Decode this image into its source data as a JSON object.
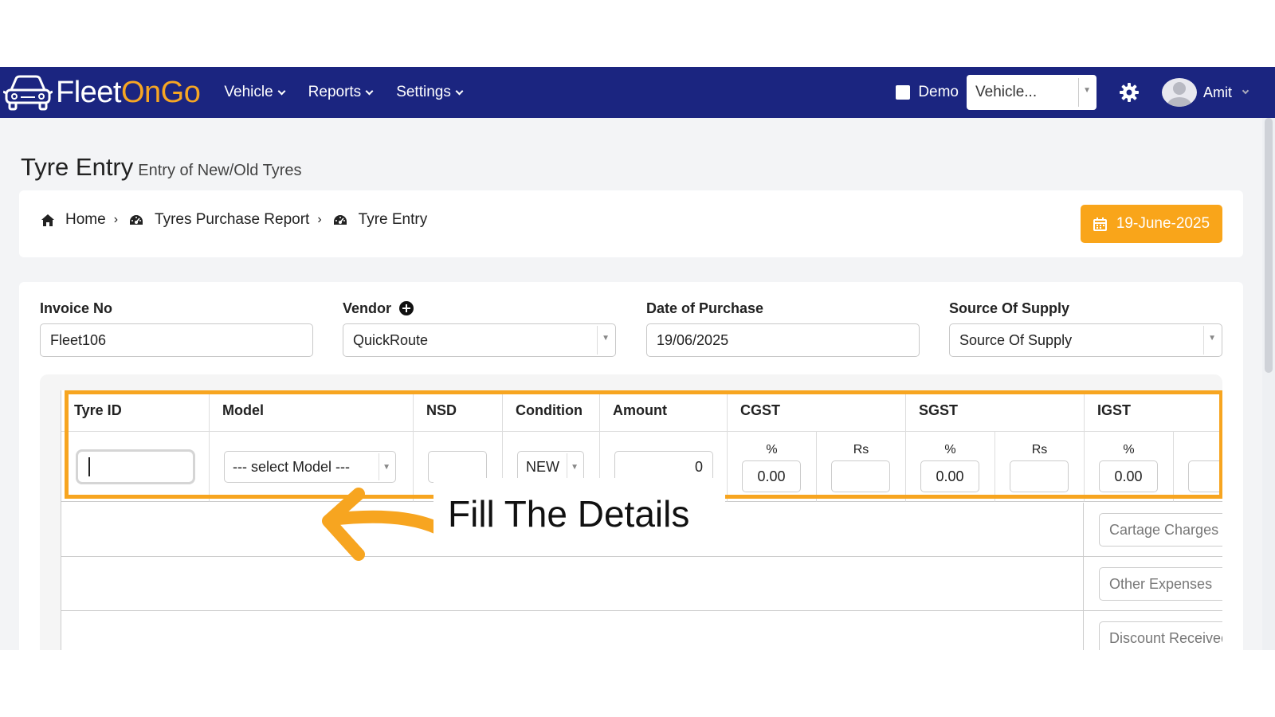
{
  "navbar": {
    "logo_text_a": "Fleet",
    "logo_text_b": "OnGo",
    "menu": [
      {
        "label": "Vehicle"
      },
      {
        "label": "Reports"
      },
      {
        "label": "Settings"
      }
    ],
    "demo_label": "Demo",
    "vehicle_select": "Vehicle...",
    "user_name": "Amit"
  },
  "page": {
    "title": "Tyre Entry",
    "subtitle": "Entry of New/Old Tyres"
  },
  "breadcrumb": {
    "items": [
      "Home",
      "Tyres Purchase Report",
      "Tyre Entry"
    ],
    "date": "19-June-2025"
  },
  "form": {
    "invoice_label": "Invoice No",
    "invoice_value": "Fleet106",
    "vendor_label": "Vendor",
    "vendor_value": "QuickRoute",
    "date_label": "Date of Purchase",
    "date_value": "19/06/2025",
    "source_label": "Source Of Supply",
    "source_value": "Source Of Supply"
  },
  "table": {
    "headers": [
      "Tyre ID",
      "Model",
      "NSD",
      "Condition",
      "Amount",
      "CGST",
      "SGST",
      "IGST"
    ],
    "model_select": "--- select Model ---",
    "condition_value": "NEW",
    "amount_value": "0",
    "pct_label": "%",
    "rs_label": "Rs",
    "cgst_pct": "0.00",
    "sgst_pct": "0.00",
    "igst_pct": "0.00",
    "extra_fields": [
      "Cartage Charges",
      "Other Expenses",
      "Discount Received"
    ]
  },
  "annotation": {
    "callout": "Fill The Details",
    "highlight_color": "#f7a520"
  },
  "colors": {
    "navbar": "#1b2580",
    "accent": "#f9a51a"
  }
}
